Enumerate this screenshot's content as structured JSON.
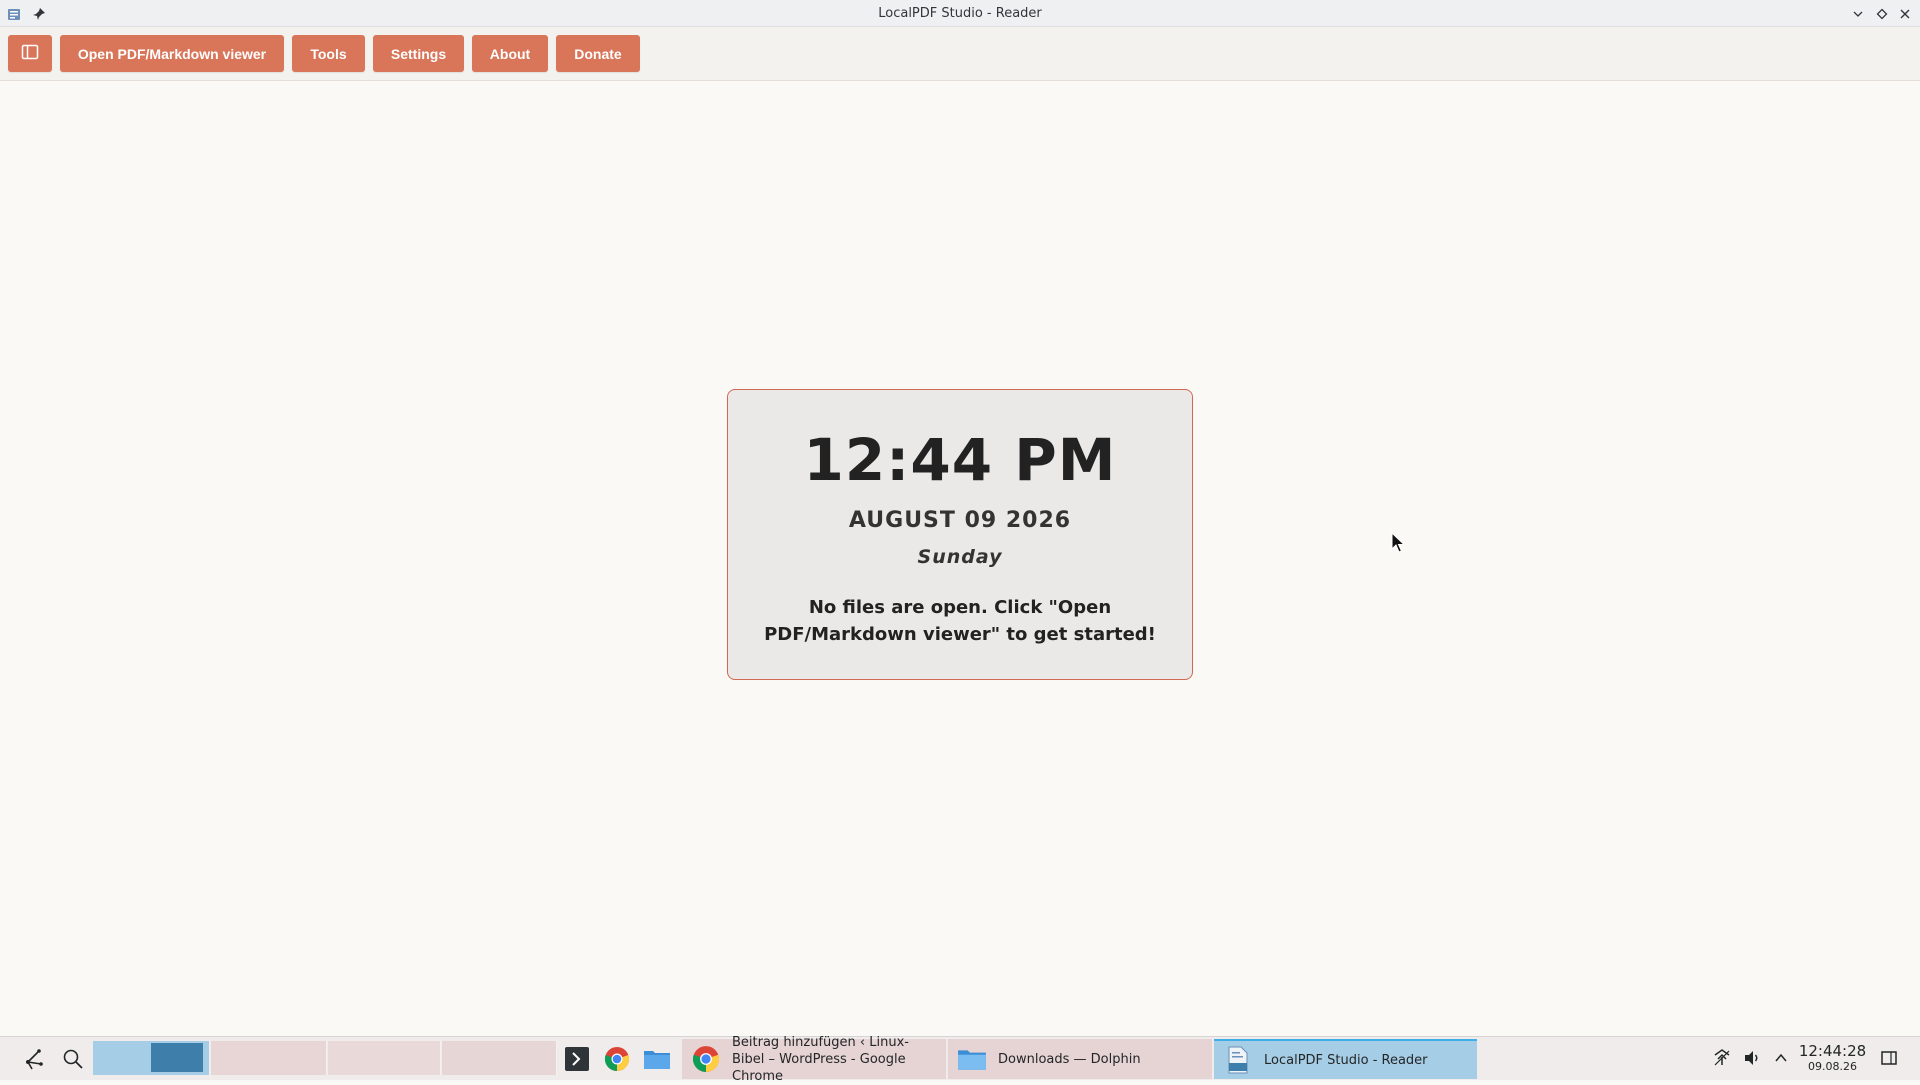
{
  "window": {
    "title": "LocalPDF Studio - Reader"
  },
  "toolbar": {
    "sidebar_toggle_icon": "sidebar-toggle-icon",
    "open_label": "Open PDF/Markdown viewer",
    "tools_label": "Tools",
    "settings_label": "Settings",
    "about_label": "About",
    "donate_label": "Donate",
    "button_color": "#d97559"
  },
  "card": {
    "time": "12:44 PM",
    "date": "AUGUST 09 2026",
    "weekday": "Sunday",
    "message": "No files are open. Click \"Open PDF/Markdown viewer\" to get started!",
    "border_color": "#d06a55"
  },
  "taskbar": {
    "tasks": [
      {
        "label": "Beitrag hinzufügen ‹ Linux-Bibel – WordPress - Google Chrome",
        "icon": "chrome-icon"
      },
      {
        "label": "Downloads — Dolphin",
        "icon": "folder-icon"
      },
      {
        "label": "LocalPDF Studio - Reader",
        "icon": "pdf-icon"
      }
    ],
    "clock_time": "12:44:28",
    "clock_date": "09.08.26"
  }
}
